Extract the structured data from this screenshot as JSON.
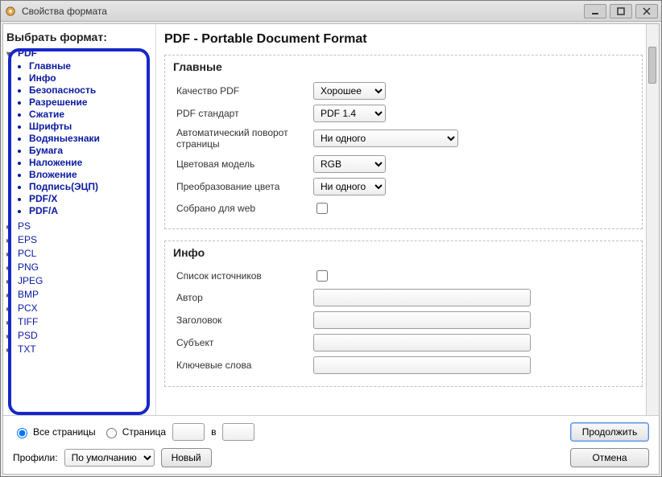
{
  "window": {
    "title": "Свойства формата"
  },
  "sidebar": {
    "header": "Выбрать формат:",
    "formats": [
      {
        "name": "PDF",
        "expanded": true,
        "sub": [
          "Главные",
          "Инфо",
          "Безопасность",
          "Разрешение",
          "Сжатие",
          "Шрифты",
          "Водяныезнаки",
          "Бумага",
          "Наложение",
          "Вложение",
          "Подпись(ЭЦП)",
          "PDF/X",
          "PDF/A"
        ]
      },
      {
        "name": "PS"
      },
      {
        "name": "EPS"
      },
      {
        "name": "PCL"
      },
      {
        "name": "PNG"
      },
      {
        "name": "JPEG"
      },
      {
        "name": "BMP"
      },
      {
        "name": "PCX"
      },
      {
        "name": "TIFF"
      },
      {
        "name": "PSD"
      },
      {
        "name": "TXT"
      }
    ]
  },
  "main": {
    "title": "PDF - Portable Document Format",
    "groups": {
      "main_group": {
        "title": "Главные",
        "quality": {
          "label": "Качество PDF",
          "value": "Хорошее"
        },
        "standard": {
          "label": "PDF стандарт",
          "value": "PDF 1.4"
        },
        "autorotate": {
          "label": "Автоматический поворот страницы",
          "value": "Ни одного"
        },
        "colormodel": {
          "label": "Цветовая модель",
          "value": "RGB"
        },
        "colorconv": {
          "label": "Преобразование цвета",
          "value": "Ни одного"
        },
        "webcollect": {
          "label": "Собрано для web",
          "checked": false
        }
      },
      "info_group": {
        "title": "Инфо",
        "sources": {
          "label": "Список источников",
          "checked": false
        },
        "author": {
          "label": "Автор",
          "value": ""
        },
        "doc_title": {
          "label": "Заголовок",
          "value": ""
        },
        "subject": {
          "label": "Субъект",
          "value": ""
        },
        "keywords": {
          "label": "Ключевые слова",
          "value": ""
        }
      }
    }
  },
  "bottom": {
    "all_pages": "Все страницы",
    "page_label": "Страница",
    "page_sep": "в",
    "page_from": "",
    "page_to": "",
    "continue": "Продолжить",
    "cancel": "Отмена",
    "profiles_label": "Профили:",
    "profile_value": "По умолчанию",
    "new_btn": "Новый"
  }
}
